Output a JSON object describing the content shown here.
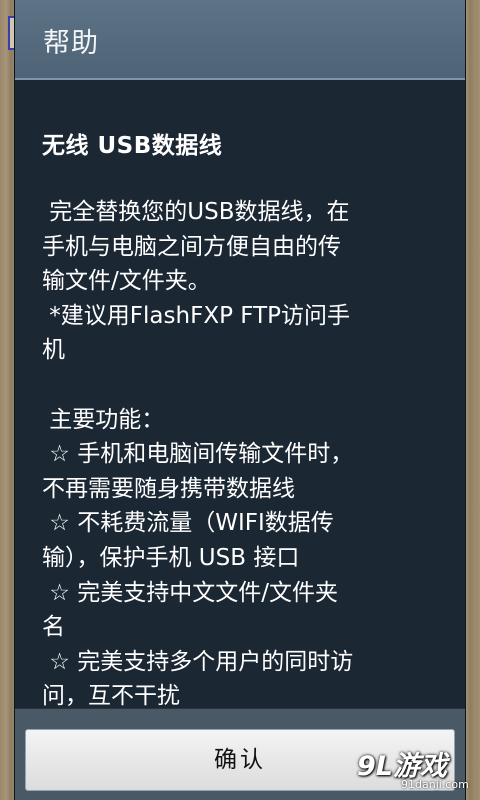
{
  "dialog": {
    "title": "帮助",
    "heading": "无线 USB数据线",
    "lines": [
      " 完全替换您的USB数据线，在",
      "手机与电脑之间方便自由的传",
      "输文件/文件夹。",
      " *建议用FlashFXP FTP访问手",
      "机",
      "",
      " 主要功能：",
      " ☆ 手机和电脑间传输文件时，",
      "不再需要随身携带数据线",
      " ☆ 不耗费流量（WIFI数据传",
      "输），保护手机 USB 接口",
      " ☆ 完美支持中文文件/文件夹",
      "名",
      " ☆ 完美支持多个用户的同时访",
      "问，互不干扰"
    ],
    "ok_label": "确认"
  },
  "watermark": {
    "main": "9L游戏",
    "sub": "91danji.com"
  }
}
